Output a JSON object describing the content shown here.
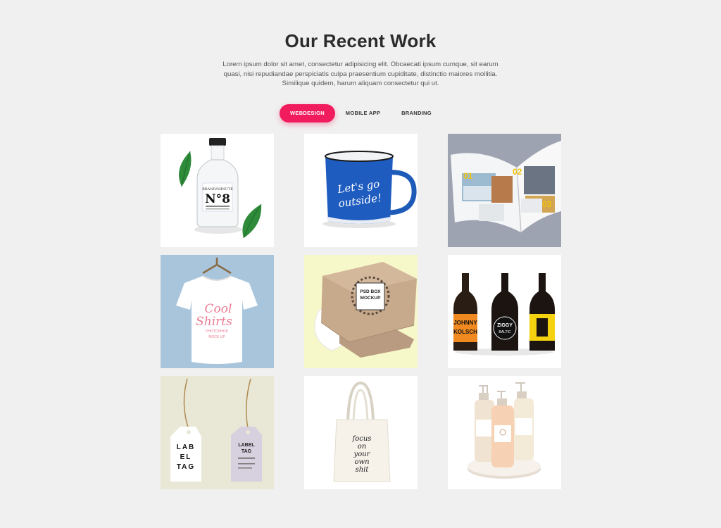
{
  "header": {
    "title": "Our Recent Work",
    "description": "Lorem ipsum dolor sit amet, consectetur adipisicing elit. Obcaecati ipsum cumque, sit earum quasi, nisi repudiandae perspiciatis culpa praesentium cupiditate, distinctio maiores mollitia. Similique quidem, harum aliquam consectetur qui ut."
  },
  "filters": [
    {
      "label": "WEBDESIGN",
      "active": true
    },
    {
      "label": "MOBILE APP",
      "active": false
    },
    {
      "label": "BRANDING",
      "active": false
    }
  ],
  "colors": {
    "accent": "#f01c5e",
    "background": "#f0f0f0",
    "heading": "#2b2b2b"
  },
  "portfolio": [
    {
      "name": "glass-bottle",
      "texts": [
        "BRAND/MINUTE",
        "N°8"
      ]
    },
    {
      "name": "enamel-mug",
      "texts": [
        "Let's go",
        "outside!"
      ]
    },
    {
      "name": "magazine-spread",
      "texts": [
        "01",
        "02",
        "03"
      ]
    },
    {
      "name": "t-shirt",
      "texts": [
        "Cool",
        "Shirts",
        "PHOTOSHOP",
        "MOCK UP"
      ]
    },
    {
      "name": "box",
      "texts": [
        "PSD BOX",
        "MOCKUP"
      ]
    },
    {
      "name": "beer-bottles",
      "texts": [
        "JOHNNY",
        "KOLSCH",
        "ZIGGY",
        "BALTIC"
      ]
    },
    {
      "name": "label-tags",
      "texts": [
        "LAB",
        "EL",
        "TAG",
        "LABEL",
        "TAG"
      ]
    },
    {
      "name": "tote-bag",
      "texts": [
        "focus",
        "on",
        "your",
        "own",
        "shit"
      ]
    },
    {
      "name": "cosmetic-bottles",
      "texts": []
    }
  ]
}
